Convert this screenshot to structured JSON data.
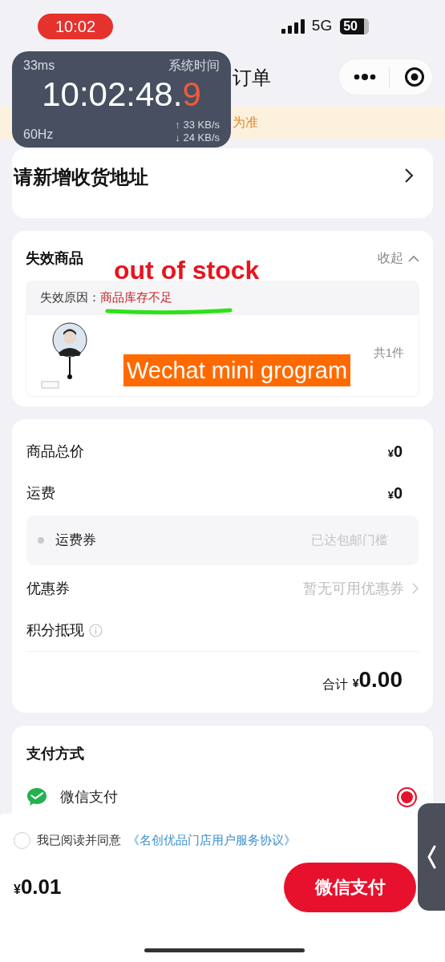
{
  "status_bar": {
    "time": "10:02",
    "network": "5G",
    "battery": "50"
  },
  "overlay_monitor": {
    "latency": "33ms",
    "mode": "系统时间",
    "time": "10:02:48.",
    "time_fraction": "9",
    "refresh_rate": "60Hz",
    "upload": "↑ 33 KB/s",
    "download": "↓ 24 KB/s"
  },
  "nav_bar": {
    "title": "订单"
  },
  "notice": {
    "text": "为准"
  },
  "address": {
    "text": "请新增收货地址"
  },
  "invalid_goods": {
    "title": "失效商品",
    "toggle": "收起",
    "expanded": true,
    "reason_label": "失效原因：",
    "reason": "商品库存不足",
    "item": {
      "count": "共1件"
    }
  },
  "summary": {
    "rows": [
      {
        "kind": "line",
        "label": "商品总价",
        "currency": "¥",
        "amount": "0"
      },
      {
        "kind": "line",
        "label": "运费",
        "currency": "¥",
        "amount": "0"
      },
      {
        "kind": "sub",
        "label": "运费券",
        "value": "已达包邮门槛"
      },
      {
        "kind": "link",
        "label": "优惠券",
        "value": "暂无可用优惠券"
      },
      {
        "kind": "info",
        "label": "积分抵现"
      }
    ],
    "total_label": "合计",
    "total_currency": "¥",
    "total": "0.00"
  },
  "payment": {
    "title": "支付方式",
    "methods": [
      {
        "name": "微信支付",
        "selected": true
      }
    ]
  },
  "footer": {
    "agreement": {
      "checked": false,
      "text": "我已阅读并同意",
      "link": "《名创优品门店用户服务协议》"
    },
    "currency": "¥",
    "amount": "0.01",
    "pay_button": "微信支付"
  },
  "annotations": [
    {
      "kind": "caption",
      "text": "out of stock"
    },
    {
      "kind": "underline"
    },
    {
      "kind": "tag",
      "text": "Wechat mini grogram"
    }
  ]
}
